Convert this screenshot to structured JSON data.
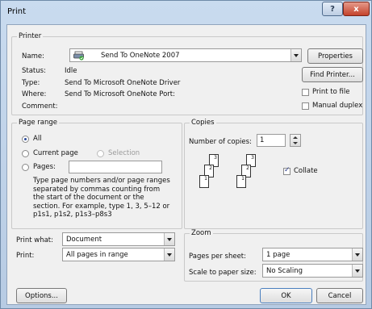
{
  "window": {
    "title": "Print",
    "help_label": "?",
    "close_label": "x"
  },
  "printer": {
    "group_title": "Printer",
    "name_label": "Name:",
    "name_value": "Send To OneNote 2007",
    "status_label": "Status:",
    "status_value": "Idle",
    "type_label": "Type:",
    "type_value": "Send To Microsoft OneNote Driver",
    "where_label": "Where:",
    "where_value": "Send To Microsoft OneNote Port:",
    "comment_label": "Comment:",
    "properties_label": "Properties",
    "find_printer_label": "Find Printer...",
    "print_to_file_label": "Print to file",
    "print_to_file_checked": false,
    "manual_duplex_label": "Manual duplex",
    "manual_duplex_checked": false
  },
  "page_range": {
    "group_title": "Page range",
    "all_label": "All",
    "current_page_label": "Current page",
    "selection_label": "Selection",
    "pages_label": "Pages:",
    "pages_value": "",
    "selected": "All",
    "help_text": "Type page numbers and/or page ranges separated by commas counting from the start of the document or the section. For example, type 1, 3, 5–12 or p1s1, p1s2, p1s3–p8s3"
  },
  "copies": {
    "group_title": "Copies",
    "number_label": "Number of copies:",
    "number_value": "1",
    "collate_label": "Collate",
    "collate_checked": true,
    "page_numbers": [
      "1",
      "2",
      "3"
    ]
  },
  "print_what": {
    "label": "Print what:",
    "value": "Document"
  },
  "print": {
    "label": "Print:",
    "value": "All pages in range"
  },
  "zoom": {
    "group_title": "Zoom",
    "pages_per_sheet_label": "Pages per sheet:",
    "pages_per_sheet_value": "1 page",
    "scale_label": "Scale to paper size:",
    "scale_value": "No Scaling"
  },
  "footer": {
    "options_label": "Options...",
    "ok_label": "OK",
    "cancel_label": "Cancel"
  }
}
